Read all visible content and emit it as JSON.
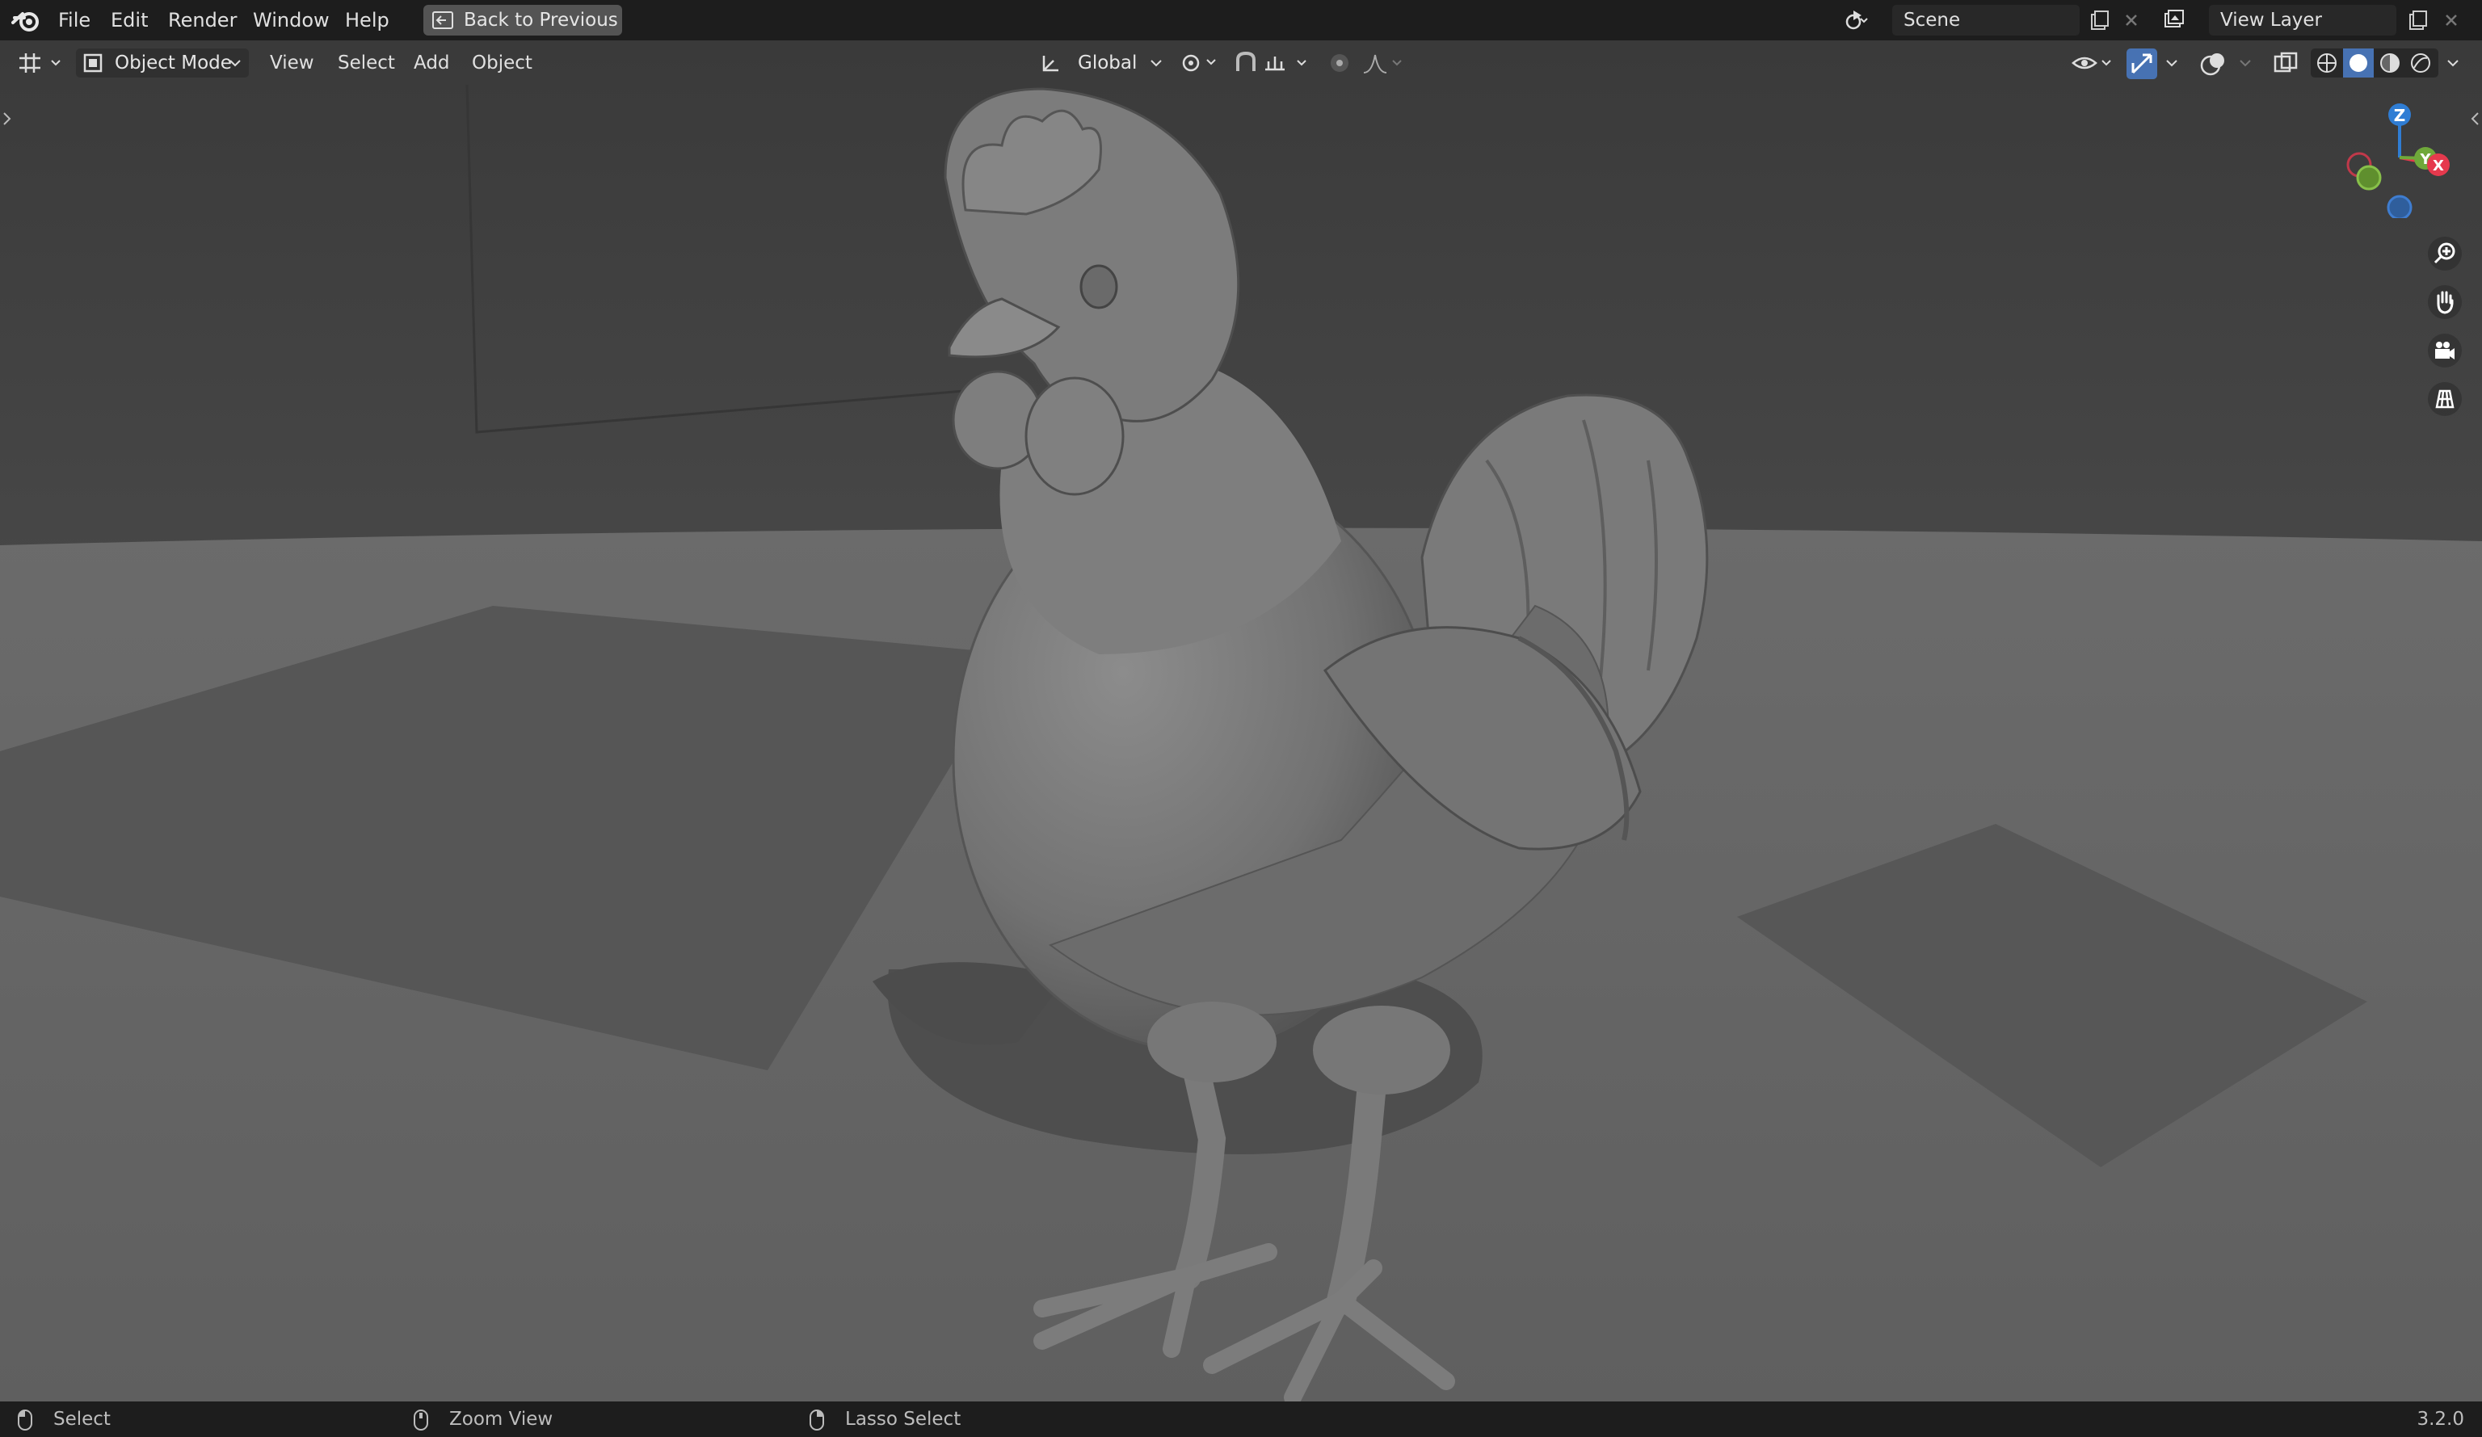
{
  "menu": {
    "items": [
      "File",
      "Edit",
      "Render",
      "Window",
      "Help"
    ],
    "back_label": "Back to Previous"
  },
  "scene": {
    "name": "Scene"
  },
  "view_layer": {
    "name": "View Layer"
  },
  "viewport_header": {
    "mode": "Object Mode",
    "menus": [
      "View",
      "Select",
      "Add",
      "Object"
    ],
    "orientation": "Global"
  },
  "gizmo": {
    "z": "Z",
    "y": "Y",
    "x": "X"
  },
  "status": {
    "items": [
      "Select",
      "Zoom View",
      "Lasso Select"
    ],
    "version": "3.2.0"
  },
  "colors": {
    "topbar": "#1d1d1d",
    "viewport_bg": "#404040",
    "floor": "#666666",
    "accent_blue": "#4772b3",
    "axis_x": "#e5394d",
    "axis_y": "#6fa83a",
    "axis_z": "#2f7dd4"
  },
  "icons": {
    "app": "blender-logo-icon",
    "editor": "editor-type-3d-viewport-icon",
    "mode": "object-mode-icon",
    "orientation": "transform-orientation-icon",
    "pivot": "pivot-point-icon",
    "snap": "snap-icon",
    "proportional": "proportional-editing-icon",
    "visibility": "eye-icon",
    "gizmo": "gizmo-toggle-icon",
    "overlay": "overlay-icon",
    "xray": "xray-icon",
    "shading": [
      "wireframe-shading-icon",
      "solid-shading-icon",
      "material-preview-icon",
      "rendered-shading-icon"
    ],
    "nav": [
      "zoom-icon",
      "pan-hand-icon",
      "camera-icon",
      "orthographic-grid-icon"
    ]
  }
}
